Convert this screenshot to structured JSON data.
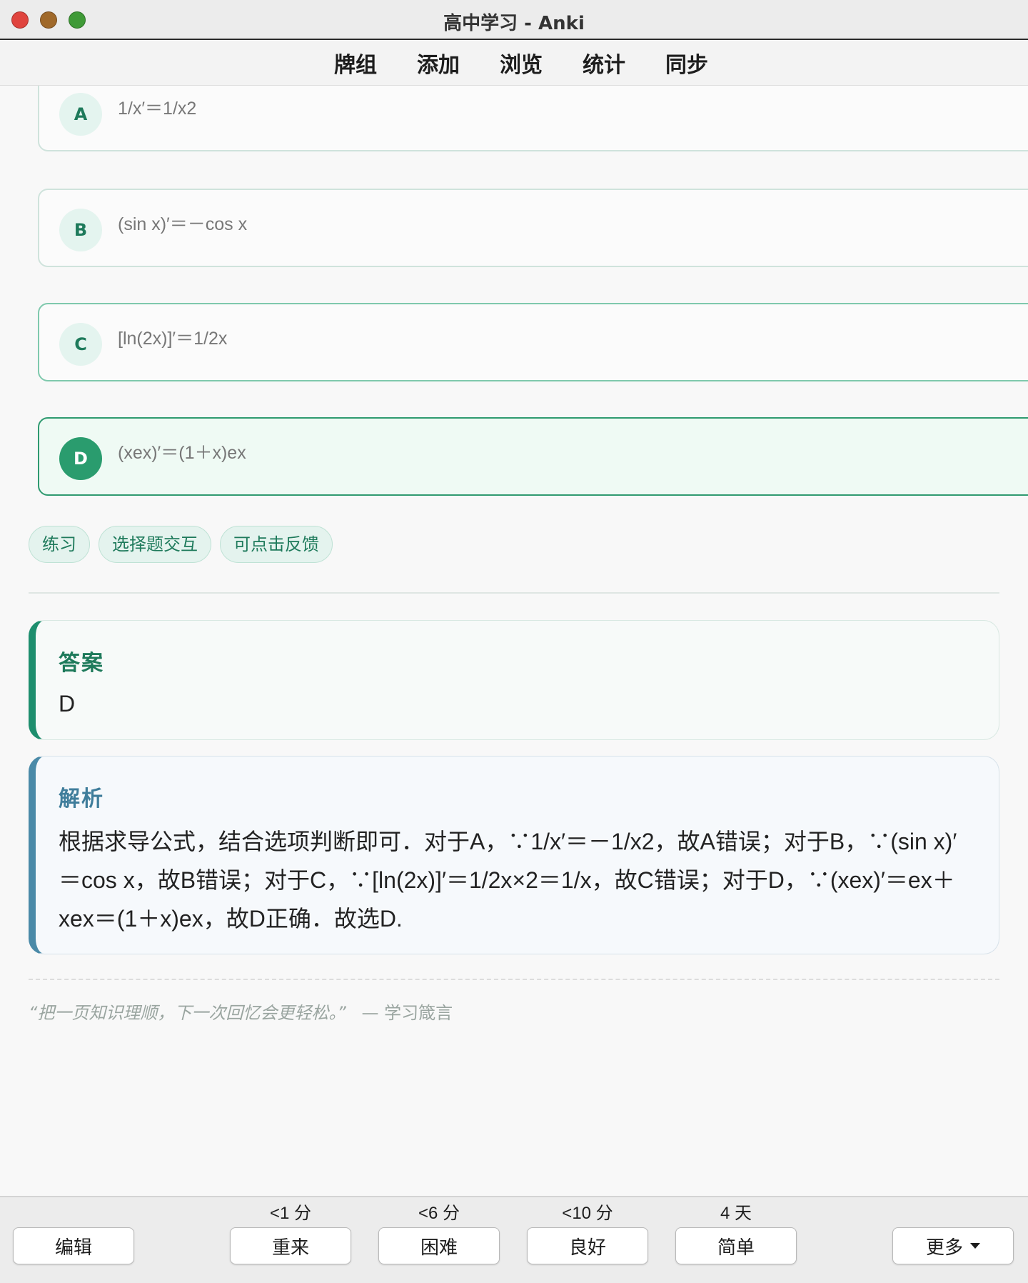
{
  "window": {
    "title": "高中学习 - Anki"
  },
  "toolbar": {
    "tabs": [
      "牌组",
      "添加",
      "浏览",
      "统计",
      "同步"
    ]
  },
  "options": [
    {
      "letter": "A",
      "text": "1/x′＝1/x2",
      "selected": false
    },
    {
      "letter": "B",
      "text": "(sin x)′＝－cos x",
      "selected": false
    },
    {
      "letter": "C",
      "text": "[ln(2x)]′＝1/2x",
      "selected": false
    },
    {
      "letter": "D",
      "text": "(xex)′＝(1＋x)ex",
      "selected": true
    }
  ],
  "tags": [
    "练习",
    "选择题交互",
    "可点击反馈"
  ],
  "answer": {
    "heading": "答案",
    "value": "D"
  },
  "analysis": {
    "heading": "解析",
    "text": "根据求导公式，结合选项判断即可．对于A，∵1/x′＝－1/x2，故A错误；对于B，∵(sin x)′＝cos x，故B错误；对于C，∵[ln(2x)]′＝1/2x×2＝1/x，故C错误；对于D，∵(xex)′＝ex＋xex＝(1＋x)ex，故D正确．故选D."
  },
  "quote": {
    "text": "“把一页知识理顺，下一次回忆会更轻松。”",
    "source": "— 学习箴言"
  },
  "bottom": {
    "edit": "编辑",
    "answers": [
      {
        "label": "重来",
        "due": "<1 分"
      },
      {
        "label": "困难",
        "due": "<6 分"
      },
      {
        "label": "良好",
        "due": "<10 分"
      },
      {
        "label": "简单",
        "due": "4 天"
      }
    ],
    "more": "更多"
  },
  "colors": {
    "accent_green": "#2a9c6e",
    "analysis_blue": "#4a8aa8"
  }
}
